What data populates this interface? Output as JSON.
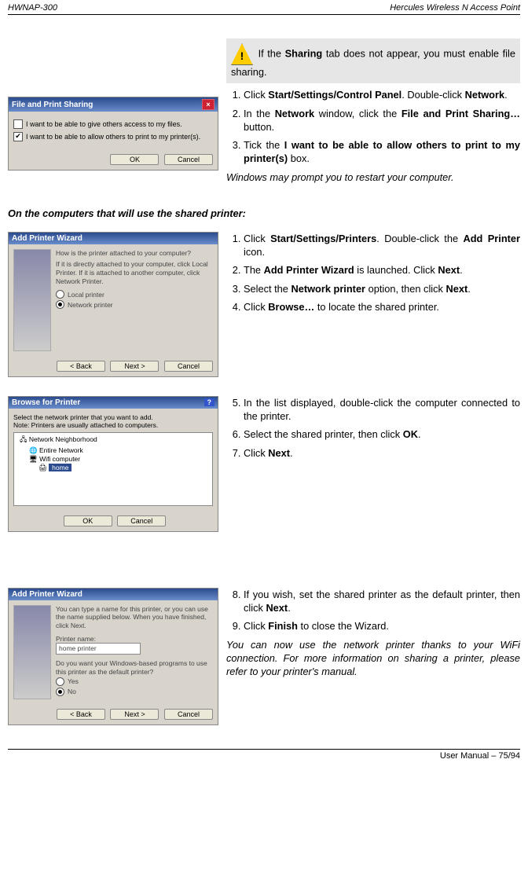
{
  "header": {
    "left": "HWNAP-300",
    "right": "Hercules Wireless N Access Point"
  },
  "note": {
    "prefix": " If the ",
    "bold1": "Sharing",
    "suffix": " tab does not appear, you must enable file sharing."
  },
  "win1": {
    "title": "File and Print Sharing",
    "check1": "I want to be able to give others access to my files.",
    "check2": "I want to be able to allow others to print to my printer(s).",
    "ok": "OK",
    "cancel": "Cancel"
  },
  "list1": {
    "i1a": "Click ",
    "i1b": "Start/Settings/Control Panel",
    "i1c": ".  Double-click ",
    "i1d": "Network",
    "i1e": ".",
    "i2a": "In the ",
    "i2b": "Network",
    "i2c": " window, click the ",
    "i2d": "File and Print Sharing…",
    "i2e": " button.",
    "i3a": "Tick the ",
    "i3b": "I want to be able to allow others to print to my printer(s)",
    "i3c": " box.",
    "note": "Windows may prompt you to restart your computer."
  },
  "subhead": "On the computers that will use the shared printer:",
  "win2": {
    "title": "Add Printer Wizard",
    "line1": "How is the printer attached to your computer?",
    "line2": "If it is directly attached to your computer, click Local Printer. If it is attached to another computer, click Network Printer.",
    "opt1": "Local printer",
    "opt2": "Network printer",
    "back": "< Back",
    "next": "Next >",
    "cancel": "Cancel"
  },
  "list2": {
    "i1a": "Click ",
    "i1b": "Start/Settings/Printers",
    "i1c": ".  Double-click the ",
    "i1d": "Add Printer",
    "i1e": " icon.",
    "i2a": "The ",
    "i2b": "Add Printer Wizard",
    "i2c": " is launched.  Click ",
    "i2d": "Next",
    "i2e": ".",
    "i3a": "Select the ",
    "i3b": "Network printer",
    "i3c": " option, then click ",
    "i3d": "Next",
    "i3e": ".",
    "i4a": "Click ",
    "i4b": "Browse…",
    "i4c": " to locate the shared printer."
  },
  "win3": {
    "title": "Browse for Printer",
    "hint1": "Select the network printer that you want to add.",
    "hint2": "Note: Printers are usually attached to computers.",
    "node1": "Network Neighborhood",
    "node2": "Entire Network",
    "node3": "Wifi computer",
    "node4": "home",
    "ok": "OK",
    "cancel": "Cancel"
  },
  "list3": {
    "i5a": "In the list displayed, double-click the computer connected to the printer.",
    "i6a": "Select the shared printer, then click ",
    "i6b": "OK",
    "i6c": ".",
    "i7a": "Click ",
    "i7b": "Next",
    "i7c": "."
  },
  "win4": {
    "title": "Add Printer Wizard",
    "line1": "You can type a name for this printer, or you can use the name supplied below. When you have finished, click Next.",
    "label": "Printer name:",
    "value": "home printer",
    "q": "Do you want your Windows-based programs to use this printer as the default printer?",
    "yes": "Yes",
    "no": "No",
    "back": "< Back",
    "next": "Next >",
    "cancel": "Cancel"
  },
  "list4": {
    "i8a": "If you wish, set the shared printer as the default printer, then click ",
    "i8b": "Next",
    "i8c": ".",
    "i9a": "Click ",
    "i9b": "Finish",
    "i9c": " to close the Wizard.",
    "note": "You can now use the network printer thanks to your WiFi connection.  For more information on sharing a printer, please refer to your printer's manual."
  },
  "footer": "User Manual – 75/94"
}
